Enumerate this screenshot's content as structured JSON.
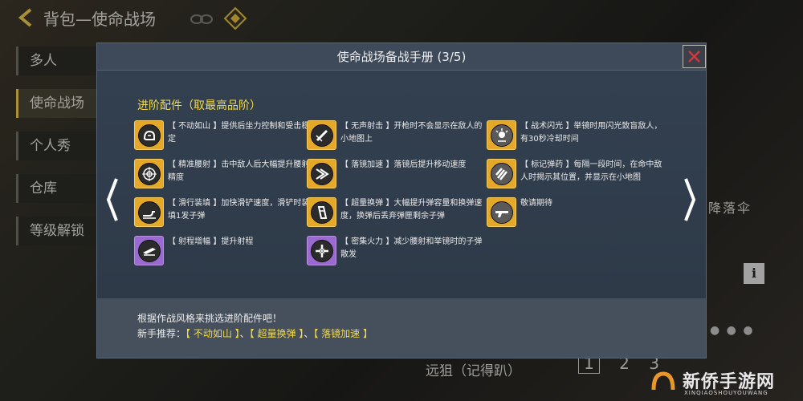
{
  "background": {
    "title": "背包—使命战场",
    "sidebar": [
      "多人",
      "使命战场",
      "个人秀",
      "仓库",
      "等级解锁"
    ],
    "active_index": 1,
    "right_text": "降落伞",
    "info_label": "i",
    "bottom_text": "远狙（记得趴）",
    "nums": [
      "1",
      "2",
      "3"
    ],
    "watermark": {
      "title": "新侨手游网",
      "sub": "XINQIAOSHOUYOUWANG"
    }
  },
  "modal": {
    "title": "使命战场备战手册 (3/5)",
    "section_title": "进阶配件（取最高品阶）",
    "items": [
      {
        "name": "【不动如山】提供后坐力控制和受击稳定",
        "text": "【 不动如山 】提供后坐力控制和受击稳定",
        "rarity": "gold",
        "icon": "hand-icon"
      },
      {
        "text": "【 无声射击 】开枪时不会显示在敌人的小地图上",
        "rarity": "gold",
        "icon": "silencer-icon"
      },
      {
        "text": "【 战术闪光 】举镜时用闪光致盲敌人，有30秒冷却时间",
        "rarity": "gold",
        "icon": "flash-icon"
      },
      {
        "text": "【 精准腰射 】击中敌人后大幅提升腰射精度",
        "rarity": "gold",
        "icon": "crosshair-icon"
      },
      {
        "text": "【 落镜加速 】落镜后提升移动速度",
        "rarity": "gold",
        "icon": "speed-icon"
      },
      {
        "text": "【 标记弹药 】每隔一段时间，在命中敌人时揭示其位置，并显示在小地图",
        "rarity": "gold",
        "icon": "bullets-icon"
      },
      {
        "text": "【 滑行装填 】加快滑铲速度，滑铲时装填1发子弹",
        "rarity": "gold",
        "icon": "slide-icon"
      },
      {
        "text": "【 超量换弹 】大幅提升弹容量和换弹速度，换弹后丢弃弹匣剩余子弹",
        "rarity": "gold",
        "icon": "magazine-icon"
      },
      {
        "text": "敬请期待",
        "rarity": "gold",
        "icon": "rifle-icon"
      },
      {
        "text": "【 射程增幅 】提升射程",
        "rarity": "purple",
        "icon": "barrel-icon"
      },
      {
        "text": "【 密集火力 】减少腰射和举镜时的子弹散发",
        "rarity": "purple",
        "icon": "dense-fire-icon"
      }
    ],
    "footer": {
      "line1": "根据作战风格来挑选进阶配件吧！",
      "line2_prefix": "新手推荐：",
      "rec1": "【 不动如山 】",
      "sep1": "、",
      "rec2": "【 超量换弹 】",
      "sep2": "、",
      "rec3": "【 落镜加速 】"
    }
  },
  "colors": {
    "accent_yellow": "#f2d94a",
    "gold_icon": "#e5a92a",
    "purple_icon": "#9b6ad1",
    "modal_bg": "#2f3a48"
  }
}
